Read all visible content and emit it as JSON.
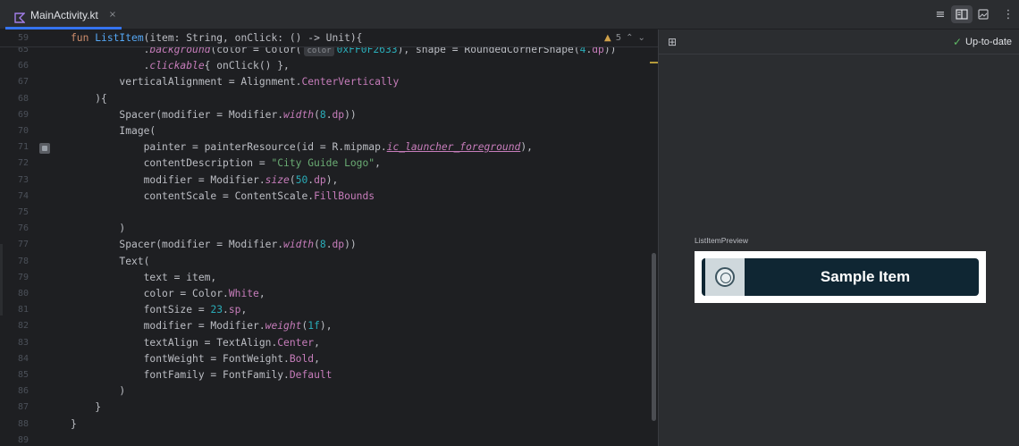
{
  "tab": {
    "label": "MainActivity.kt",
    "close": "×"
  },
  "toolbar": {
    "code_view": "≡",
    "split_view": "▯▯",
    "design_view": "⊡",
    "more": "⋮"
  },
  "editor": {
    "warnings": {
      "count": "5",
      "up": "⌃",
      "down": "⌄"
    },
    "lines": [
      {
        "n": "59",
        "segs": [
          [
            "kw",
            "fun "
          ],
          [
            "fn",
            "ListItem"
          ],
          [
            "",
            "(item: String, onClick: () -> Unit){"
          ]
        ]
      },
      {
        "n": "65",
        "segs": [
          [
            "",
            "            ."
          ],
          [
            "ital",
            "background"
          ],
          [
            "",
            "(color = Color("
          ],
          [
            "hint",
            "color"
          ],
          [
            "num",
            "0xFF0F2633"
          ],
          [
            "",
            "), shape = RoundedCornerShape("
          ],
          [
            "num",
            "4"
          ],
          [
            "",
            "."
          ],
          [
            "prop",
            "dp"
          ],
          [
            "",
            "))"
          ]
        ]
      },
      {
        "n": "66",
        "segs": [
          [
            "",
            "            ."
          ],
          [
            "ital",
            "clickable"
          ],
          [
            "",
            ""
          ],
          [
            "",
            ""
          ],
          [
            "",
            "{ onClick() },"
          ]
        ]
      },
      {
        "n": "67",
        "segs": [
          [
            "",
            "        verticalAlignment = Alignment."
          ],
          [
            "prop",
            "CenterVertically"
          ]
        ]
      },
      {
        "n": "68",
        "segs": [
          [
            "",
            "    ){"
          ]
        ]
      },
      {
        "n": "69",
        "segs": [
          [
            "",
            "        Spacer(modifier = Modifier."
          ],
          [
            "ital",
            "width"
          ],
          [
            "",
            "("
          ],
          [
            "num",
            "8"
          ],
          [
            "",
            "."
          ],
          [
            "prop",
            "dp"
          ],
          [
            "",
            "))"
          ]
        ]
      },
      {
        "n": "70",
        "segs": [
          [
            "",
            "        Image("
          ]
        ]
      },
      {
        "n": "71",
        "segs": [
          [
            "",
            "            painter = painterResource(id = R.mipmap."
          ],
          [
            "ital ul",
            "ic_launcher_foreground"
          ],
          [
            "",
            "),"
          ]
        ]
      },
      {
        "n": "72",
        "segs": [
          [
            "",
            "            contentDescription = "
          ],
          [
            "str",
            "\"City Guide Logo\""
          ],
          [
            "",
            ","
          ]
        ]
      },
      {
        "n": "73",
        "segs": [
          [
            "",
            "            modifier = Modifier."
          ],
          [
            "ital",
            "size"
          ],
          [
            "",
            "("
          ],
          [
            "num",
            "50"
          ],
          [
            "",
            "."
          ],
          [
            "prop",
            "dp"
          ],
          [
            "",
            "),"
          ]
        ]
      },
      {
        "n": "74",
        "segs": [
          [
            "",
            "            contentScale = ContentScale."
          ],
          [
            "prop",
            "FillBounds"
          ]
        ]
      },
      {
        "n": "75",
        "segs": [
          [
            "",
            ""
          ]
        ]
      },
      {
        "n": "76",
        "segs": [
          [
            "",
            "        )"
          ]
        ]
      },
      {
        "n": "77",
        "segs": [
          [
            "",
            "        Spacer(modifier = Modifier."
          ],
          [
            "ital",
            "width"
          ],
          [
            "",
            "("
          ],
          [
            "num",
            "8"
          ],
          [
            "",
            "."
          ],
          [
            "prop",
            "dp"
          ],
          [
            "",
            "))"
          ]
        ]
      },
      {
        "n": "78",
        "segs": [
          [
            "",
            "        Text("
          ]
        ]
      },
      {
        "n": "79",
        "segs": [
          [
            "",
            "            text = item,"
          ]
        ]
      },
      {
        "n": "80",
        "segs": [
          [
            "",
            "            color = Color."
          ],
          [
            "prop",
            "White"
          ],
          [
            "",
            ","
          ]
        ]
      },
      {
        "n": "81",
        "segs": [
          [
            "",
            "            fontSize = "
          ],
          [
            "num",
            "23"
          ],
          [
            "",
            "."
          ],
          [
            "prop",
            "sp"
          ],
          [
            "",
            ","
          ]
        ]
      },
      {
        "n": "82",
        "segs": [
          [
            "",
            "            modifier = Modifier."
          ],
          [
            "ital",
            "weight"
          ],
          [
            "",
            "("
          ],
          [
            "num",
            "1f"
          ],
          [
            "",
            "),"
          ]
        ]
      },
      {
        "n": "83",
        "segs": [
          [
            "",
            "            textAlign = TextAlign."
          ],
          [
            "prop",
            "Center"
          ],
          [
            "",
            ","
          ]
        ]
      },
      {
        "n": "84",
        "segs": [
          [
            "",
            "            fontWeight = FontWeight."
          ],
          [
            "prop",
            "Bold"
          ],
          [
            "",
            ","
          ]
        ]
      },
      {
        "n": "85",
        "segs": [
          [
            "",
            "            fontFamily = FontFamily."
          ],
          [
            "prop",
            "Default"
          ]
        ]
      },
      {
        "n": "86",
        "segs": [
          [
            "",
            "        )"
          ]
        ]
      },
      {
        "n": "87",
        "segs": [
          [
            "",
            "    }"
          ]
        ]
      },
      {
        "n": "88",
        "segs": [
          [
            "",
            "}"
          ]
        ]
      },
      {
        "n": "89",
        "segs": [
          [
            "",
            ""
          ]
        ]
      }
    ]
  },
  "preview": {
    "status": "Up-to-date",
    "check": "✓",
    "layout_icon": "⊞",
    "name": "ListItemPreview",
    "item_text": "Sample Item"
  },
  "colors": {
    "accent": "#3574f0",
    "item_bg": "#0F2633",
    "ok": "#5fb865"
  }
}
